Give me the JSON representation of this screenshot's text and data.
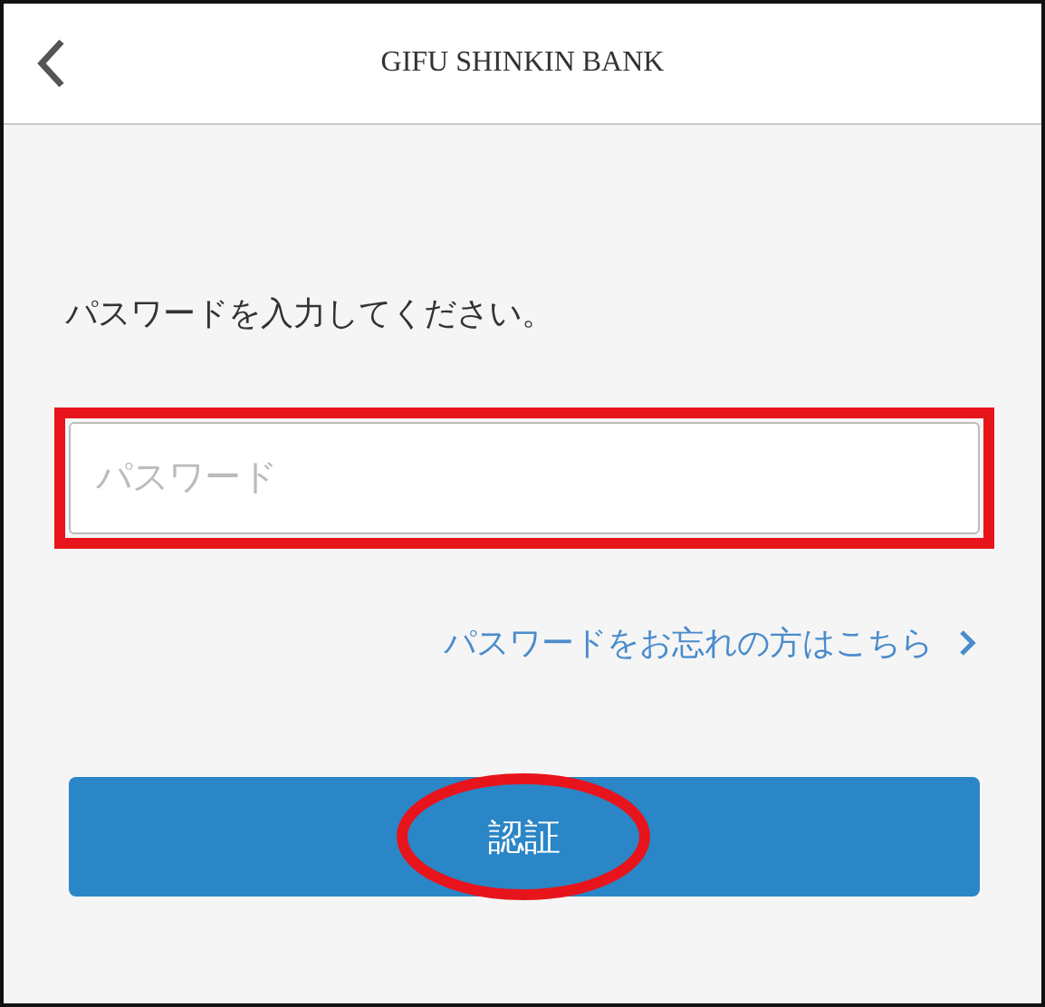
{
  "header": {
    "title": "GIFU SHINKIN BANK"
  },
  "prompt": "パスワードを入力してください。",
  "password_field": {
    "placeholder": "パスワード",
    "highlighted": true
  },
  "forgot_link": {
    "label": "パスワードをお忘れの方はこちら"
  },
  "submit_button": {
    "label": "認証",
    "highlighted": true
  }
}
